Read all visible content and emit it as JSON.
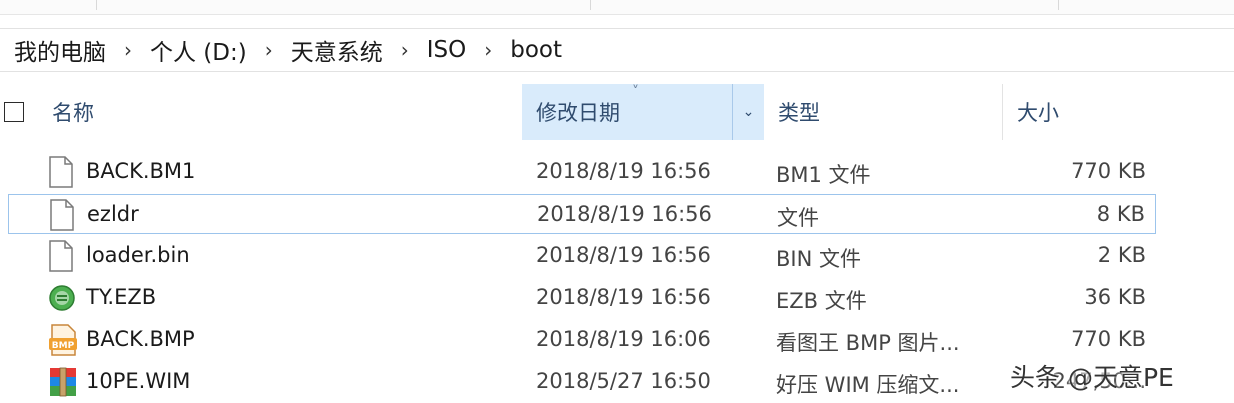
{
  "breadcrumb": {
    "items": [
      "我的电脑",
      "个人 (D:)",
      "天意系统",
      "ISO",
      "boot"
    ],
    "separator": "›"
  },
  "columns": {
    "name": "名称",
    "date": "修改日期",
    "type": "类型",
    "size": "大小",
    "sort_indicator": "˅",
    "dropdown": "⌄"
  },
  "files": [
    {
      "name": "BACK.BM1",
      "date": "2018/8/19 16:56",
      "type": "BM1 文件",
      "size": "770 KB",
      "icon": "generic-file-icon"
    },
    {
      "name": "ezldr",
      "date": "2018/8/19 16:56",
      "type": "文件",
      "size": "8 KB",
      "icon": "generic-file-icon"
    },
    {
      "name": "loader.bin",
      "date": "2018/8/19 16:56",
      "type": "BIN 文件",
      "size": "2 KB",
      "icon": "generic-file-icon"
    },
    {
      "name": "TY.EZB",
      "date": "2018/8/19 16:56",
      "type": "EZB 文件",
      "size": "36 KB",
      "icon": "ezb-icon"
    },
    {
      "name": "BACK.BMP",
      "date": "2018/8/19 16:06",
      "type": "看图王 BMP 图片...",
      "size": "770 KB",
      "icon": "bmp-icon"
    },
    {
      "name": "10PE.WIM",
      "date": "2018/5/27 16:50",
      "type": "好压 WIM 压缩文...",
      "size": "247,50...",
      "icon": "archive-icon"
    }
  ],
  "focused_row": 1,
  "watermark": "头条 @天意PE",
  "colors": {
    "header_text": "#2f4b6e",
    "sorted_column_bg": "#d9ebfb",
    "focus_border": "#9cc4ec"
  }
}
